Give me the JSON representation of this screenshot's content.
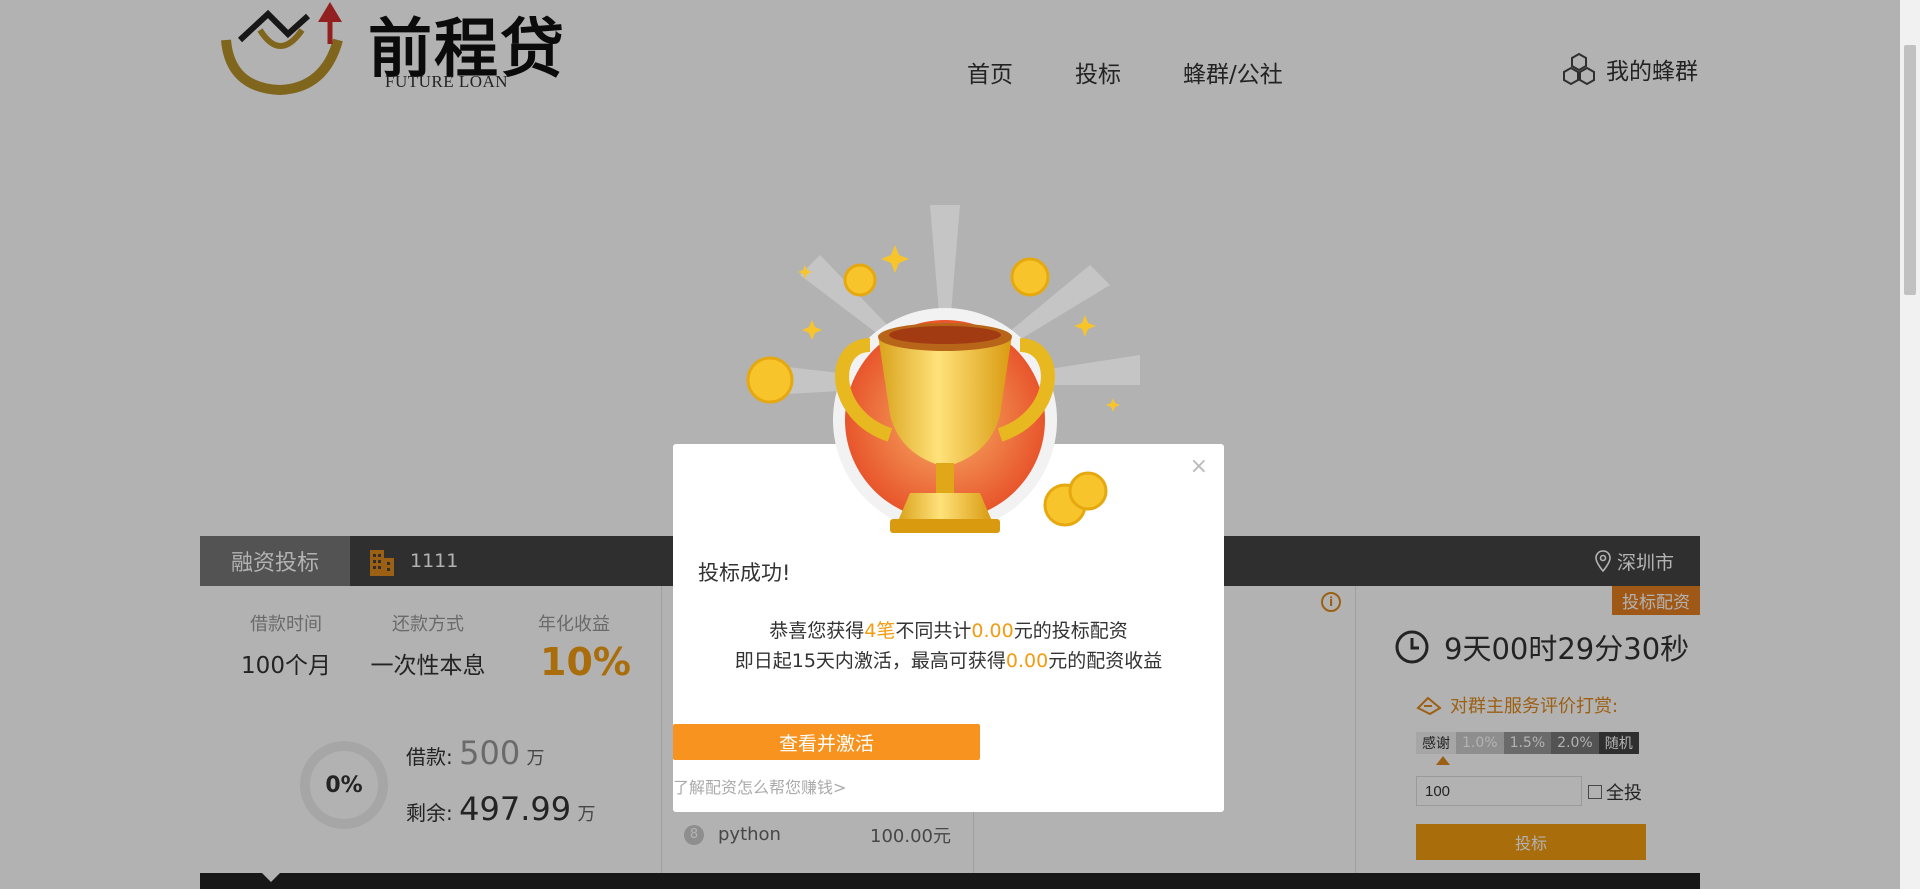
{
  "header": {
    "logo_text": "前程贷",
    "logo_sub": "FUTURE LOAN",
    "nav": [
      "首页",
      "投标",
      "蜂群/公社"
    ],
    "my_swarm": "我的蜂群"
  },
  "panel": {
    "tab_active": "融资投标",
    "project_name": "1111",
    "city": "深圳市",
    "stats": {
      "term_label": "借款时间",
      "term_value": "100个月",
      "repay_label": "还款方式",
      "repay_value": "一次性本息",
      "yield_label": "年化收益",
      "yield_value": "10%"
    },
    "progress": "0%",
    "loan_label": "借款:",
    "loan_amount": "500",
    "loan_unit": "万",
    "remain_label": "剩余:",
    "remain_amount": "497.99",
    "remain_unit": "万",
    "investor_rows": [
      {
        "num": "8",
        "name": "python",
        "amount": "100.00元"
      }
    ],
    "badge": "投标配资",
    "timer": "9天00时29分30秒",
    "rate_title": "对群主服务评价打赏:",
    "tips": [
      "感谢",
      "1.0%",
      "1.5%",
      "2.0%",
      "随机"
    ],
    "amount_value": "100",
    "all_label": "全投",
    "invest_button": "投标"
  },
  "modal": {
    "title": "投标成功!",
    "line1_a": "恭喜您获得",
    "line1_count": "4笔",
    "line1_b": "不同共计",
    "line1_amount": "0.00",
    "line1_c": "元的投标配资",
    "line2_a": "即日起15天内激活，最高可获得",
    "line2_amount": "0.00",
    "line2_b": "元的配资收益",
    "activate_button": "查看并激活",
    "learn_link": "了解配资怎么帮您赚钱>",
    "close": "×"
  },
  "colors": {
    "accent": "#f39c12",
    "dark_bar": "#444444",
    "overlay": "rgba(0,0,0,0.30)"
  }
}
